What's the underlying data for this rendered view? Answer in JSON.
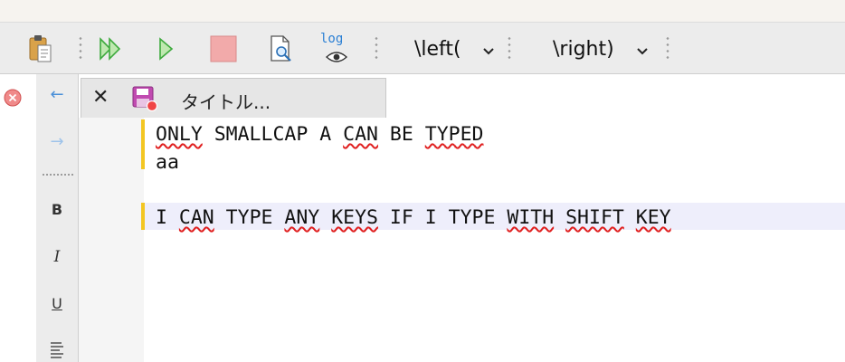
{
  "toolbar": {
    "log_label": "log",
    "left_dropdown": "\\left(",
    "right_dropdown": "\\right)"
  },
  "side_tools": {
    "back": "←",
    "forward": "→",
    "bold": "B",
    "italic": "I",
    "underline": "U"
  },
  "tab": {
    "close": "✕",
    "title": "タイトル..."
  },
  "editor": {
    "lines": [
      {
        "segments": [
          {
            "text": "ONLY",
            "err": true
          },
          {
            "text": " SMALLCAP A ",
            "err": false
          },
          {
            "text": "CAN",
            "err": true
          },
          {
            "text": " BE ",
            "err": false
          },
          {
            "text": "TYPED",
            "err": true
          }
        ]
      },
      {
        "segments": [
          {
            "text": "aa",
            "err": false
          }
        ]
      },
      {
        "segments": [
          {
            "text": "",
            "err": false
          }
        ]
      },
      {
        "segments": [
          {
            "text": "I ",
            "err": false
          },
          {
            "text": "CAN",
            "err": true
          },
          {
            "text": " TYPE ",
            "err": false
          },
          {
            "text": "ANY",
            "err": true
          },
          {
            "text": " ",
            "err": false
          },
          {
            "text": "KEYS",
            "err": true
          },
          {
            "text": " IF I TYPE ",
            "err": false
          },
          {
            "text": "WITH",
            "err": true
          },
          {
            "text": " ",
            "err": false
          },
          {
            "text": "SHIFT",
            "err": true
          },
          {
            "text": " ",
            "err": false
          },
          {
            "text": "KEY",
            "err": true
          }
        ]
      }
    ]
  },
  "colors": {
    "accent_green": "#3daa3d",
    "stop_red": "#f2aaaa",
    "marker_yellow": "#f3c623",
    "highlight": "#eeeefb",
    "spell_error": "#e02020"
  }
}
